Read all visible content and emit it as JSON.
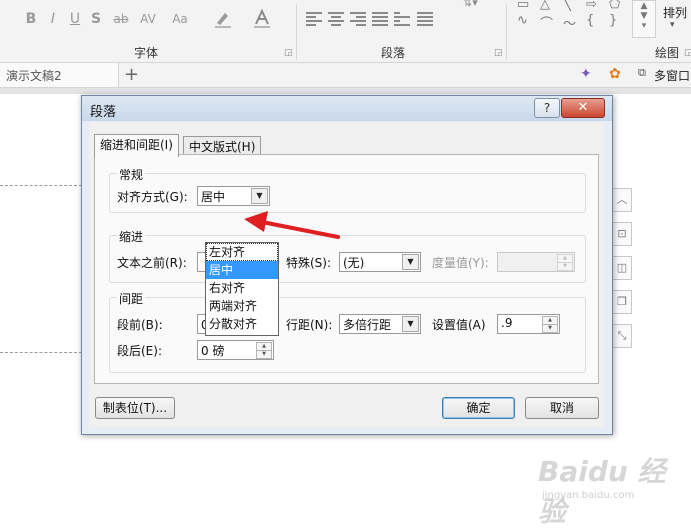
{
  "ribbon": {
    "font_group": {
      "label": "字体",
      "buttons": [
        "B",
        "I",
        "U",
        "S",
        "ab",
        "AV",
        "Aa"
      ]
    },
    "paragraph_group": {
      "label": "段落"
    },
    "drawing_group": {
      "label": "绘图",
      "arrange_label": "排列"
    }
  },
  "tabbar": {
    "doc_tab": "演示文稿2",
    "add_tab": "+",
    "window_label": "多窗口"
  },
  "dialog": {
    "title": "段落",
    "help": "?",
    "close": "✕",
    "tabs": [
      {
        "label": "缩进和间距(I)",
        "active": true
      },
      {
        "label": "中文版式(H)",
        "active": false
      }
    ],
    "general": {
      "title": "常规",
      "alignment_label": "对齐方式(G):",
      "alignment_value": "居中",
      "alignment_options": [
        "左对齐",
        "居中",
        "右对齐",
        "两端对齐",
        "分散对齐"
      ]
    },
    "indent": {
      "title": "缩进",
      "before_text_label": "文本之前(R):",
      "special_label": "特殊(S):",
      "special_value": "(无)",
      "by_label": "度量值(Y):"
    },
    "spacing": {
      "title": "间距",
      "before_label": "段前(B):",
      "before_value": "0 磅",
      "after_label": "段后(E):",
      "after_value": "0 磅",
      "line_spacing_label": "行距(N):",
      "line_spacing_value": "多倍行距",
      "at_label": "设置值(A)",
      "at_value": ".9"
    },
    "buttons": {
      "tabs": "制表位(T)...",
      "ok": "确定",
      "cancel": "取消"
    }
  },
  "watermark": {
    "brand": "Baidu 经验",
    "url": "jingyan.baidu.com"
  },
  "colors": {
    "selection": "#3399ff",
    "annotation_arrow": "#e02020",
    "close_button": "#c9452f"
  }
}
